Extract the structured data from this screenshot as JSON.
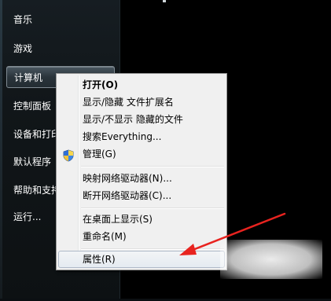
{
  "start_menu": {
    "items": [
      {
        "label": "音乐"
      },
      {
        "label": "游戏"
      },
      {
        "label": "计算机"
      },
      {
        "label": "控制面板"
      },
      {
        "label": "设备和打印机"
      },
      {
        "label": "默认程序"
      },
      {
        "label": "帮助和支持"
      },
      {
        "label": "运行..."
      }
    ]
  },
  "context_menu": {
    "items": [
      {
        "label": "打开(O)"
      },
      {
        "label": "显示/隐藏 文件扩展名"
      },
      {
        "label": "显示/不显示 隐藏的文件"
      },
      {
        "label": "搜索Everything..."
      },
      {
        "label": "管理(G)",
        "icon": "uac-shield-icon"
      },
      {
        "label": "映射网络驱动器(N)..."
      },
      {
        "label": "断开网络驱动器(C)..."
      },
      {
        "label": "在桌面上显示(S)"
      },
      {
        "label": "重命名(M)"
      },
      {
        "label": "属性(R)"
      }
    ]
  },
  "colors": {
    "annotation_arrow": "#e8231f",
    "menu_background": "#f0f0f0",
    "start_menu_background": "#111619"
  }
}
